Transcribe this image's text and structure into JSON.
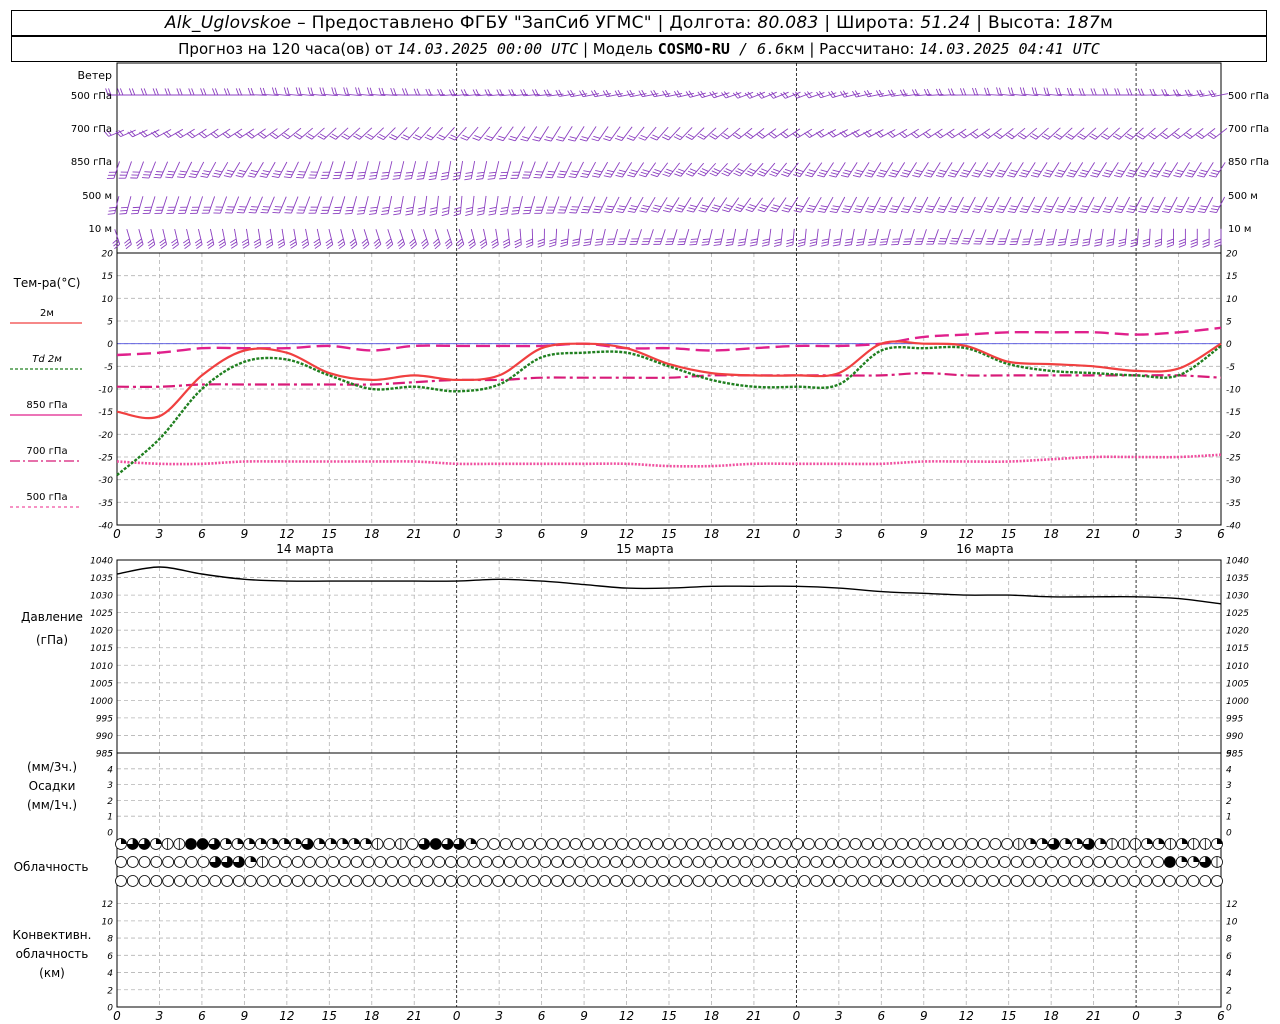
{
  "header": {
    "station": "Alk_Uglovskoe",
    "provider_label": " – Предоставлено ФГБУ \"ЗапСиб УГМС\" | Долгота: ",
    "lon": "80.083",
    "lat_label": " | Широта: ",
    "lat": "51.24",
    "height_label": " | Высота: ",
    "height": "187",
    "height_unit": "м",
    "forecast_label": "Прогноз на 120 часа(ов) от ",
    "forecast_time": "14.03.2025 00:00 UTC",
    "model_label": "  | Модель ",
    "model": "COSMO-RU",
    "model_res": " / 6.6",
    "res_unit": "км",
    "calc_label": " | Рассчитано: ",
    "calc_time": "14.03.2025 04:41 UTC"
  },
  "labels": {
    "wind_title": "Ветер",
    "wind_levels": [
      "500 гПа",
      "700 гПа",
      "850 гПа",
      "500  м",
      "10   м"
    ],
    "temp_title": "Тем-ра(°С)",
    "legend": [
      "2м",
      "Td  2м",
      "850 гПа",
      "700 гПа",
      "500 гПа"
    ],
    "pressure_title": "Давление",
    "pressure_unit": "(гПа)",
    "precip_unit_top": "(мм/3ч.)",
    "precip_title": "Осадки",
    "precip_unit_bottom": "(мм/1ч.)",
    "cloud_title": "Облачность",
    "conv_title1": "Конвективн.",
    "conv_title2": "облачность",
    "conv_unit": "(км)",
    "days": [
      "14 марта",
      "15 марта",
      "16 марта"
    ],
    "hour_ticks": [
      "0",
      "3",
      "6",
      "9",
      "12",
      "15",
      "18",
      "21",
      "0",
      "3",
      "6",
      "9",
      "12",
      "15",
      "18",
      "21",
      "0",
      "3",
      "6",
      "9",
      "12",
      "15",
      "18",
      "21",
      "0",
      "3",
      "6"
    ]
  },
  "colors": {
    "t2m": "#f04040",
    "td2m": "#208020",
    "t850": "#e0208c",
    "t700": "#d81a78",
    "t500": "#f050a0",
    "wind": "#8b3fc0",
    "pressure": "#000000",
    "grid": "#b4b4b4"
  },
  "chart_data": [
    {
      "type": "line",
      "title": "Тем-ра(°С)",
      "xlabel": "",
      "ylabel": "Тем-ра(°С)",
      "x_hours": [
        0,
        3,
        6,
        9,
        12,
        15,
        18,
        21,
        24,
        27,
        30,
        33,
        36,
        39,
        42,
        45,
        48,
        51,
        54,
        57,
        60,
        63,
        66,
        69,
        72,
        75,
        78
      ],
      "ylim": [
        -40,
        20
      ],
      "yticks": [
        20,
        15,
        10,
        5,
        0,
        -5,
        -10,
        -15,
        -20,
        -25,
        -30,
        -35,
        -40
      ],
      "series": [
        {
          "name": "2м",
          "values": [
            -15,
            -16,
            -7,
            -1.5,
            -2,
            -6.5,
            -8,
            -7,
            -8,
            -7,
            -1,
            0,
            -1,
            -4.5,
            -6.5,
            -7,
            -7,
            -6.5,
            0,
            0,
            -0.5,
            -4,
            -4.5,
            -5,
            -6,
            -5.5,
            0
          ]
        },
        {
          "name": "Td  2м",
          "values": [
            -29,
            -21,
            -10,
            -4,
            -3.5,
            -7,
            -10,
            -9.5,
            -10.5,
            -9,
            -3,
            -2,
            -2,
            -5,
            -8,
            -9.5,
            -9.5,
            -9,
            -1.5,
            -1,
            -1,
            -4.5,
            -6,
            -6.5,
            -7,
            -7,
            -0.5
          ]
        },
        {
          "name": "850 гПа",
          "values": [
            -2.5,
            -2,
            -1,
            -1,
            -1,
            -0.5,
            -1.5,
            -0.5,
            -0.5,
            -0.5,
            -0.5,
            0,
            -1,
            -1,
            -1.5,
            -1,
            -0.5,
            -0.5,
            0,
            1.5,
            2,
            2.5,
            2.5,
            2.5,
            2,
            2.5,
            3.5
          ]
        },
        {
          "name": "700 гПа",
          "values": [
            -9.5,
            -9.5,
            -9,
            -9,
            -9,
            -9,
            -9,
            -8.5,
            -8,
            -8,
            -7.5,
            -7.5,
            -7.5,
            -7.5,
            -7,
            -7,
            -7,
            -7,
            -7,
            -6.5,
            -7,
            -7,
            -7,
            -7,
            -7,
            -7,
            -7.5
          ]
        },
        {
          "name": "500 гПа",
          "values": [
            -26,
            -26.5,
            -26.5,
            -26,
            -26,
            -26,
            -26,
            -26,
            -26.5,
            -26.5,
            -26.5,
            -26.5,
            -26.5,
            -27,
            -27,
            -26.5,
            -26.5,
            -26.5,
            -26.5,
            -26,
            -26,
            -26,
            -25.5,
            -25,
            -25,
            -25,
            -24.5
          ]
        }
      ]
    },
    {
      "type": "line",
      "title": "Давление",
      "xlabel": "",
      "ylabel": "(гПа)",
      "x_hours": [
        0,
        3,
        6,
        9,
        12,
        15,
        18,
        21,
        24,
        27,
        30,
        33,
        36,
        39,
        42,
        45,
        48,
        51,
        54,
        57,
        60,
        63,
        66,
        69,
        72,
        75,
        78
      ],
      "ylim": [
        985,
        1040
      ],
      "yticks": [
        1040,
        1035,
        1030,
        1025,
        1020,
        1015,
        1010,
        1005,
        1000,
        995,
        990,
        985
      ],
      "series": [
        {
          "name": "Давление",
          "values": [
            1036,
            1038,
            1036,
            1034.5,
            1034,
            1034,
            1034,
            1034,
            1034,
            1034.5,
            1034,
            1033,
            1032,
            1032,
            1032.5,
            1032.5,
            1032.5,
            1032,
            1031,
            1030.5,
            1030,
            1030,
            1029.5,
            1029.5,
            1029.5,
            1029,
            1027.5
          ]
        }
      ]
    },
    {
      "type": "bar",
      "title": "Осадки",
      "ylabel": "(мм/1ч.)",
      "ylim": [
        0,
        5
      ],
      "yticks": [
        5,
        4,
        3,
        2,
        1,
        0
      ],
      "values": []
    },
    {
      "type": "bar",
      "title": "Конвективн. облачность",
      "ylabel": "(км)",
      "ylim": [
        0,
        13
      ],
      "yticks": [
        12,
        10,
        8,
        6,
        4,
        2,
        0
      ],
      "values": []
    }
  ],
  "wind": {
    "levels": [
      "500 гПа",
      "700 гПа",
      "850 гПа",
      "500  м",
      "10   м"
    ],
    "direction_deg": [
      [
        270,
        270,
        270,
        270,
        275,
        275,
        275,
        270,
        265,
        265,
        265,
        260,
        260,
        260,
        255,
        250,
        250,
        255,
        260,
        265,
        270,
        275,
        275,
        270,
        270,
        265,
        260
      ],
      [
        250,
        245,
        240,
        240,
        235,
        230,
        230,
        225,
        225,
        220,
        215,
        215,
        220,
        225,
        230,
        235,
        240,
        245,
        245,
        240,
        240,
        235,
        230,
        230,
        230,
        235,
        235
      ],
      [
        200,
        205,
        210,
        215,
        210,
        200,
        195,
        195,
        190,
        195,
        205,
        210,
        215,
        220,
        225,
        225,
        220,
        215,
        215,
        215,
        215,
        215,
        215,
        215,
        215,
        215,
        215
      ],
      [
        195,
        200,
        200,
        205,
        205,
        200,
        195,
        190,
        185,
        190,
        200,
        205,
        210,
        215,
        215,
        220,
        215,
        210,
        210,
        210,
        210,
        210,
        210,
        210,
        210,
        210,
        210
      ],
      [
        160,
        165,
        165,
        170,
        170,
        165,
        160,
        160,
        160,
        170,
        180,
        190,
        200,
        200,
        195,
        190,
        185,
        190,
        195,
        200,
        205,
        200,
        195,
        190,
        185,
        180,
        180
      ]
    ]
  },
  "clouds": {
    "rows": [
      [
        2,
        3,
        3,
        2,
        1,
        1,
        4,
        4,
        3,
        2,
        2,
        2,
        2,
        2,
        2,
        2,
        3,
        2,
        2,
        2,
        2,
        2,
        1,
        0,
        1,
        0,
        3,
        4,
        3,
        3,
        2,
        0,
        0,
        0,
        0,
        0,
        0,
        0,
        0,
        0,
        0,
        0,
        0,
        0,
        0,
        0,
        0,
        0,
        0,
        0,
        0,
        0,
        0,
        0,
        0,
        0,
        0,
        0,
        0,
        0,
        0,
        0,
        0,
        0,
        0,
        0,
        0,
        0,
        0,
        0,
        0,
        0,
        0,
        0,
        0,
        0,
        0,
        1,
        2,
        2,
        3,
        2,
        2,
        3,
        2,
        1,
        1,
        1,
        2,
        2,
        1,
        2,
        1,
        1,
        2
      ],
      [
        0,
        0,
        0,
        0,
        0,
        0,
        0,
        0,
        3,
        3,
        3,
        2,
        1,
        0,
        0,
        0,
        0,
        0,
        0,
        0,
        0,
        0,
        0,
        0,
        0,
        0,
        0,
        0,
        0,
        0,
        0,
        0,
        0,
        0,
        0,
        0,
        0,
        0,
        0,
        0,
        0,
        0,
        0,
        0,
        0,
        0,
        0,
        0,
        0,
        0,
        0,
        0,
        0,
        0,
        0,
        0,
        0,
        0,
        0,
        0,
        0,
        0,
        0,
        0,
        0,
        0,
        0,
        0,
        0,
        0,
        0,
        0,
        0,
        0,
        0,
        0,
        0,
        0,
        0,
        0,
        0,
        0,
        0,
        0,
        0,
        0,
        0,
        0,
        0,
        4,
        2,
        2,
        3,
        1
      ],
      [
        0,
        0,
        0,
        0,
        0,
        0,
        0,
        0,
        0,
        0,
        0,
        0,
        0,
        0,
        0,
        0,
        0,
        0,
        0,
        0,
        0,
        0,
        0,
        0,
        0,
        0,
        0,
        0,
        0,
        0,
        0,
        0,
        0,
        0,
        0,
        0,
        0,
        0,
        0,
        0,
        0,
        0,
        0,
        0,
        0,
        0,
        0,
        0,
        0,
        0,
        0,
        0,
        0,
        0,
        0,
        0,
        0,
        0,
        0,
        0,
        0,
        0,
        0,
        0,
        0,
        0,
        0,
        0,
        0,
        0,
        0,
        0,
        0,
        0,
        0,
        0,
        0,
        0,
        0,
        0,
        0,
        0,
        0,
        0,
        0,
        0,
        0,
        0,
        0,
        0,
        0,
        0,
        0,
        0
      ]
    ]
  }
}
